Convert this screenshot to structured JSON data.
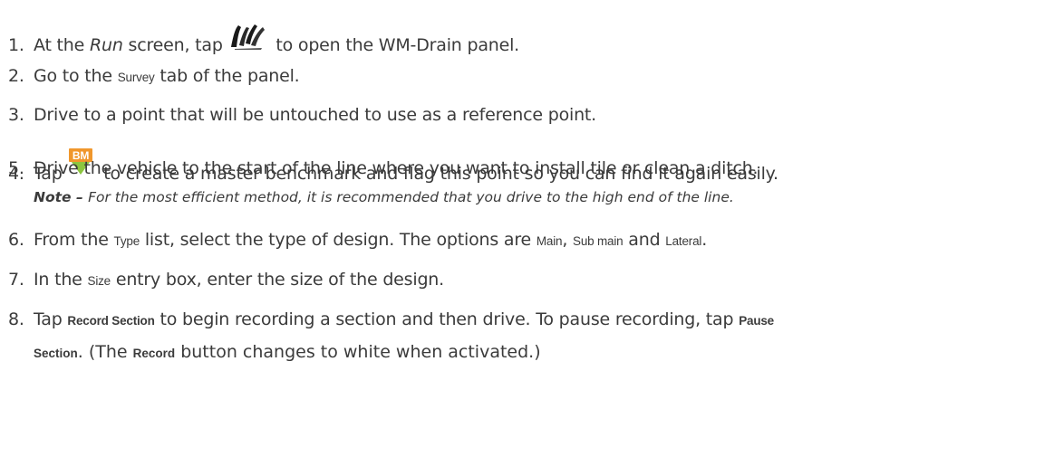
{
  "steps": [
    {
      "num": "1.",
      "parts": [
        "At the ",
        "Run",
        " screen, tap ",
        " to open the WM-Drain panel."
      ],
      "icon": "wm-drain-icon"
    },
    {
      "num": "2.",
      "parts": [
        "Go to the ",
        "Survey",
        " tab of the panel."
      ]
    },
    {
      "num": "3.",
      "parts": [
        "Drive to a point that will be untouched to use as a reference point."
      ]
    },
    {
      "num": "4.",
      "parts": [
        "Tap ",
        " to create a master benchmark and flag this point so you can find it again easily."
      ],
      "icon": "benchmark-icon",
      "icon_text": "BM"
    },
    {
      "num": "5.",
      "parts": [
        "Drive the vehicle to the start of the line where you want to install tile or clean a ditch."
      ]
    },
    {
      "num": "6.",
      "parts": [
        "From the ",
        "Type",
        " list, select the type of design. The options are ",
        "Main",
        ", ",
        "Sub main",
        " and ",
        "Lateral",
        "."
      ]
    },
    {
      "num": "7.",
      "parts": [
        "In the ",
        "Size",
        " entry box, enter the size of the design."
      ]
    },
    {
      "num": "8.",
      "parts": [
        "Tap ",
        "Record Section",
        " to begin recording a section and then drive. To pause recording, tap ",
        "Pause",
        "Section",
        ". (The ",
        "Record",
        " button changes to white when activated.)"
      ]
    }
  ],
  "note": {
    "label": "Note",
    "dash": " – ",
    "text": "For the most efficient method, it is recommended that you drive to the high end of the line."
  },
  "colors": {
    "text": "#3b3b3b",
    "bm_orange": "#f0972c",
    "bm_green": "#8cc63f",
    "icon_dark": "#1a1a1a"
  }
}
